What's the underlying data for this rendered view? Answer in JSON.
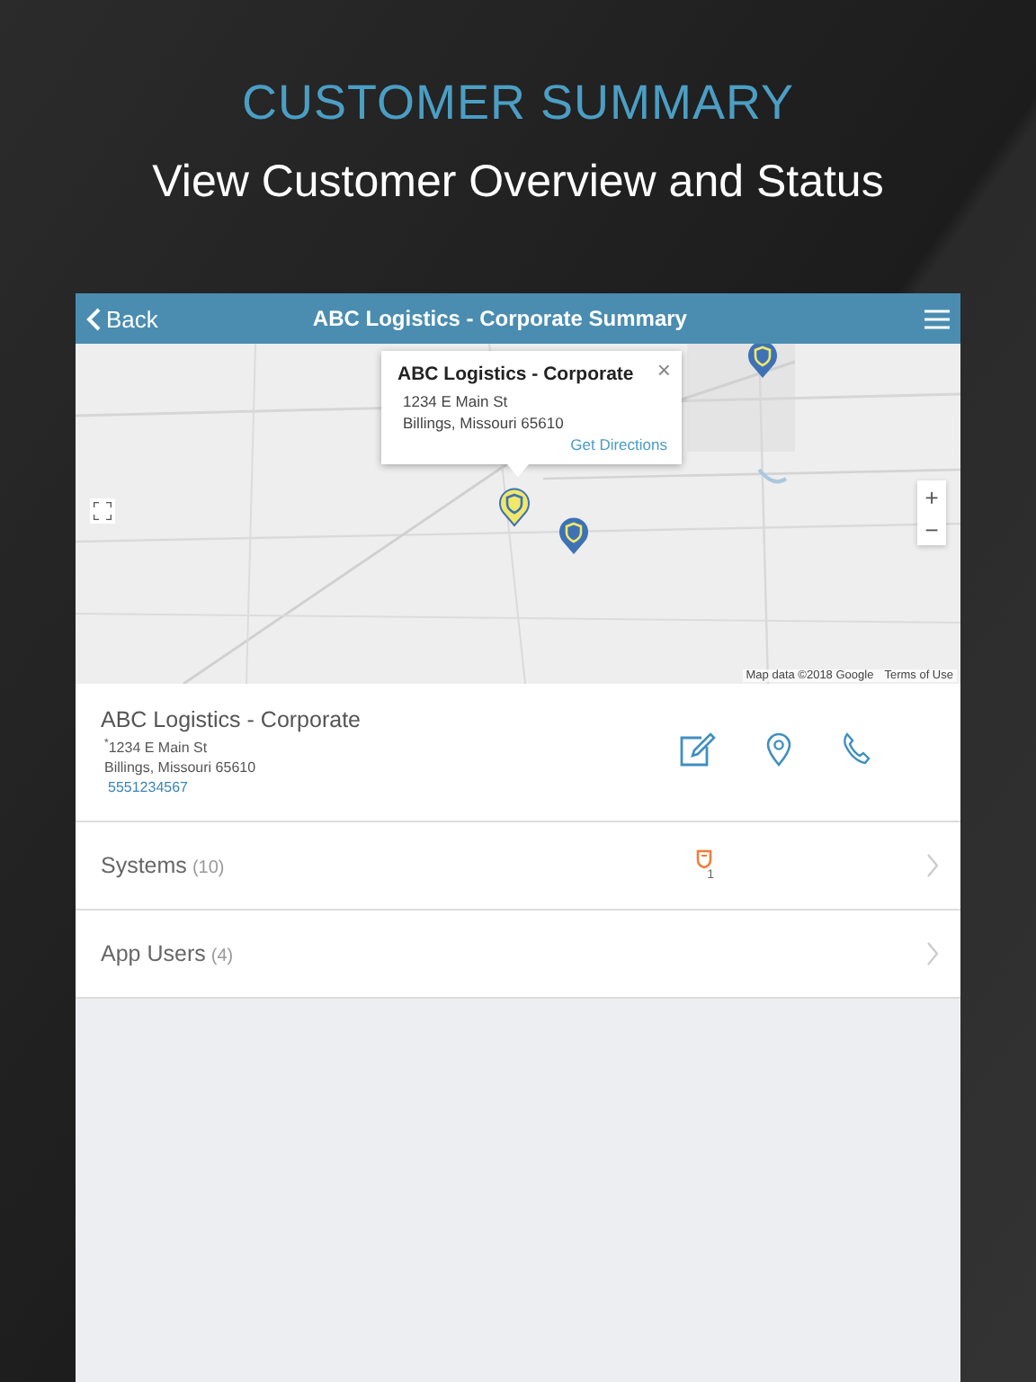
{
  "header": {
    "title": "CUSTOMER SUMMARY",
    "subtitle": "View Customer Overview and Status"
  },
  "nav": {
    "back": "Back",
    "title": "ABC Logistics - Corporate Summary"
  },
  "map": {
    "popup": {
      "title": "ABC Logistics - Corporate",
      "close": "×",
      "lines": [
        "1234 E Main St",
        "Billings, Missouri 65610"
      ],
      "link": "Get Directions"
    },
    "zoom_in": "+",
    "zoom_out": "−",
    "attribution": "Map data ©2018 Google",
    "terms": "Terms of Use",
    "pins": [
      {
        "kind": "selected"
      },
      {
        "kind": "normal"
      },
      {
        "kind": "normal"
      }
    ]
  },
  "customer": {
    "name": "ABC Logistics - Corporate",
    "address": [
      "$^{*}$1234 E Main St",
      "Billings, Missouri 65610"
    ],
    "phone": "5551234567"
  },
  "rows": [
    {
      "label": "Systems",
      "count": "(10)",
      "alerts": "1"
    },
    {
      "label": "App Users",
      "count": "(4)"
    }
  ]
}
